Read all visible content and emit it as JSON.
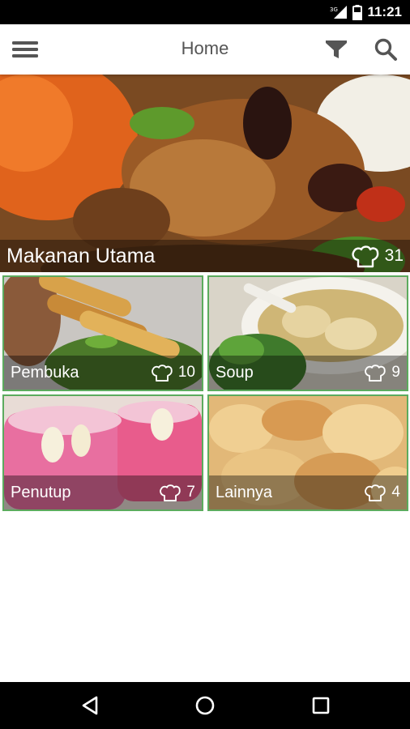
{
  "status_bar": {
    "time": "11:21",
    "network_label": "3G",
    "icons": [
      "signal-icon",
      "battery-icon"
    ]
  },
  "app_bar": {
    "title": "Home",
    "icons": [
      "menu-icon",
      "filter-icon",
      "search-icon"
    ]
  },
  "categories": [
    {
      "name": "Makanan Utama",
      "count": "31",
      "icon": "chef-hat-icon"
    },
    {
      "name": "Pembuka",
      "count": "10",
      "icon": "chef-hat-icon"
    },
    {
      "name": "Soup",
      "count": "9",
      "icon": "chef-hat-icon"
    },
    {
      "name": "Penutup",
      "count": "7",
      "icon": "chef-hat-icon"
    },
    {
      "name": "Lainnya",
      "count": "4",
      "icon": "chef-hat-icon"
    }
  ],
  "colors": {
    "tile_border": "#5cab5e",
    "app_bar_bg": "#ffffff",
    "system_bar_bg": "#000000"
  },
  "nav_bar": {
    "icons": [
      "back-icon",
      "home-icon",
      "recents-icon"
    ]
  }
}
